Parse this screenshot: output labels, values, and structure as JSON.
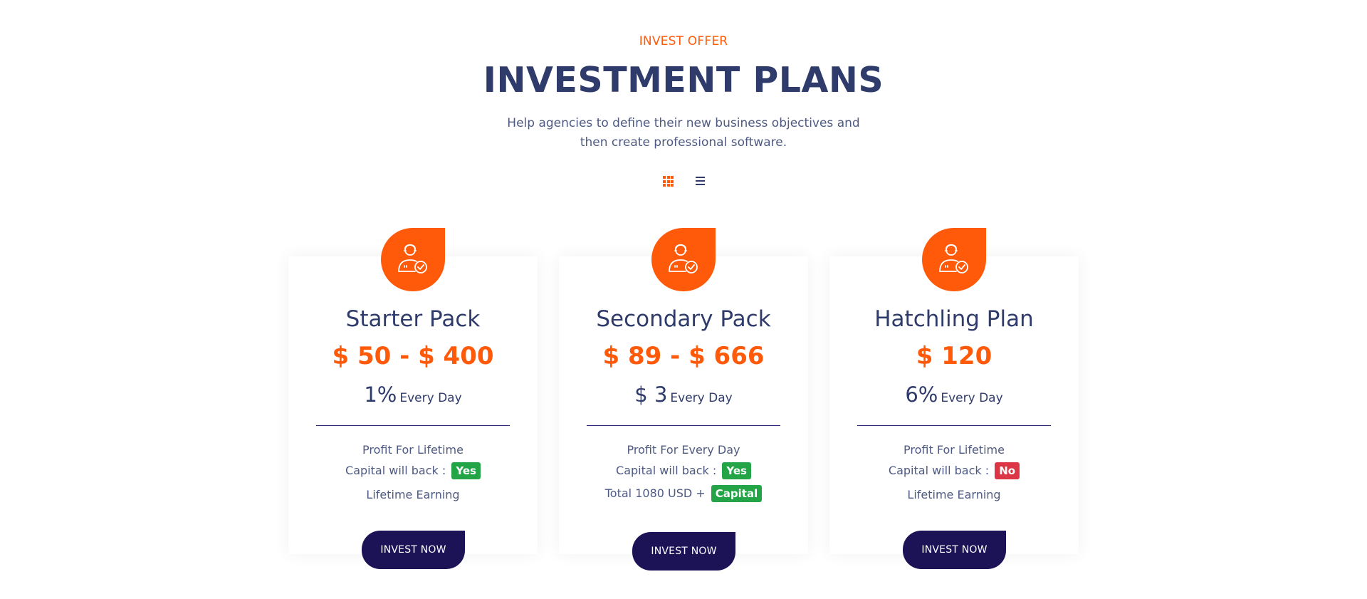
{
  "header": {
    "eyebrow": "INVEST OFFER",
    "title": "INVESTMENT PLANS",
    "subtitle": "Help agencies to define their new business objectives and then create professional software."
  },
  "view_toggle": {
    "active": "grid",
    "options": [
      "grid",
      "list"
    ]
  },
  "colors": {
    "accent": "#ff5a0a",
    "navy": "#1c1357",
    "heading": "#2f3b6a",
    "yes": "#22a447",
    "no": "#dc3545"
  },
  "plans": [
    {
      "icon": "user-check-icon",
      "name": "Starter Pack",
      "price": "$ 50 - $ 400",
      "rate_value": "1%",
      "rate_period": "Every Day",
      "features": [
        {
          "text": "Profit For Lifetime"
        },
        {
          "text": "Capital will back :",
          "badge": "Yes",
          "badge_type": "green"
        },
        {
          "text": "Lifetime Earning"
        }
      ],
      "button": "INVEST NOW"
    },
    {
      "icon": "user-check-icon",
      "name": "Secondary Pack",
      "price": "$ 89 - $ 666",
      "rate_value": "$ 3",
      "rate_period": "Every Day",
      "features": [
        {
          "text": "Profit For Every Day"
        },
        {
          "text": "Capital will back :",
          "badge": "Yes",
          "badge_type": "green"
        },
        {
          "text": "Total 1080 USD +",
          "badge": "Capital",
          "badge_type": "green"
        }
      ],
      "button": "INVEST NOW"
    },
    {
      "icon": "user-check-icon",
      "name": "Hatchling Plan",
      "price": "$ 120",
      "rate_value": "6%",
      "rate_period": "Every Day",
      "features": [
        {
          "text": "Profit For Lifetime"
        },
        {
          "text": "Capital will back :",
          "badge": "No",
          "badge_type": "red"
        },
        {
          "text": "Lifetime Earning"
        }
      ],
      "button": "INVEST NOW"
    }
  ]
}
